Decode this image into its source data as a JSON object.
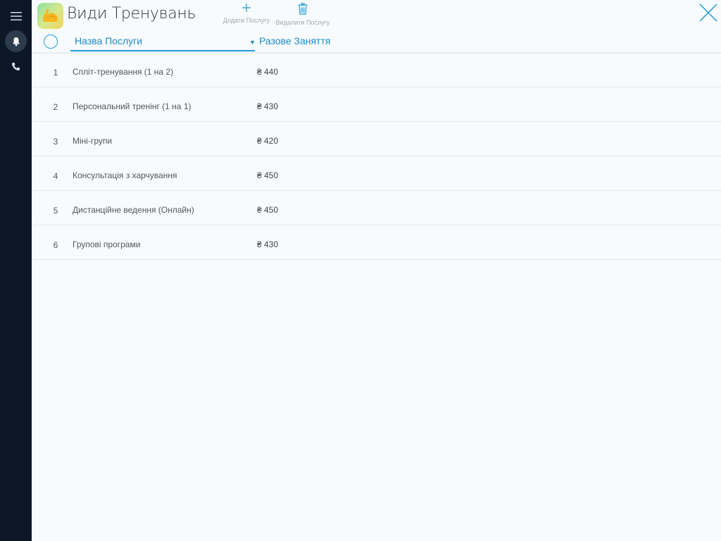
{
  "app": {
    "title": "Види Тренувань",
    "icon": "flexed-bicep-icon"
  },
  "toolbar": {
    "add_label": "Додати Послугу",
    "delete_label": "Видалити Послугу"
  },
  "table": {
    "columns": {
      "name": "Назва Послуги",
      "price": "Разове Заняття"
    },
    "rows": [
      {
        "num": "1",
        "name": "Спліт-тренування (1 на 2)",
        "price": "₴ 440"
      },
      {
        "num": "2",
        "name": "Персональний тренінг (1 на 1)",
        "price": "₴ 430"
      },
      {
        "num": "3",
        "name": "Міні-групи",
        "price": "₴ 420"
      },
      {
        "num": "4",
        "name": "Консультація з харчування",
        "price": "₴ 450"
      },
      {
        "num": "5",
        "name": "Дистанційне ведення (Онлайн)",
        "price": "₴ 450"
      },
      {
        "num": "6",
        "name": "Групові програми",
        "price": "₴ 430"
      }
    ]
  },
  "colors": {
    "accent": "#1e9ad6",
    "sidebar": "#0c1727",
    "background": "#f7fbfd"
  }
}
